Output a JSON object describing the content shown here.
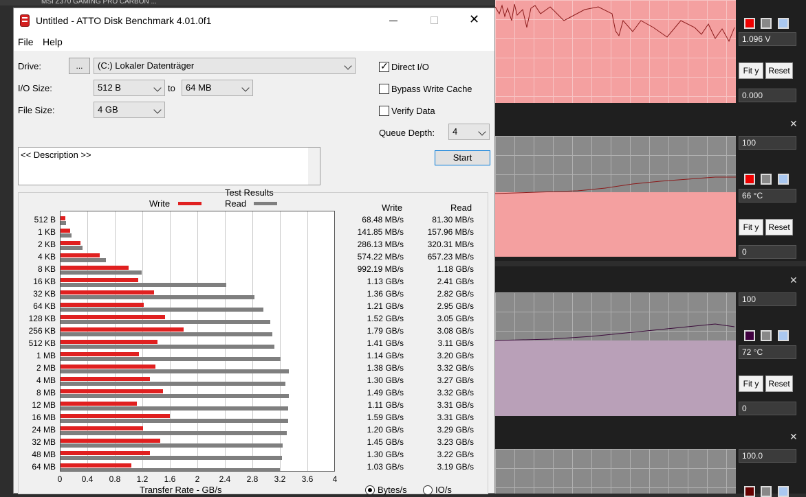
{
  "background": {
    "window_title": "MSI Z370 GAMING PRO CARBON ...",
    "panels": [
      {
        "value_top": "1.096 V",
        "value_bottom": "0.000"
      },
      {
        "value_top": "100",
        "value_mid": "66 °C",
        "value_bottom": "0"
      },
      {
        "value_top": "100",
        "value_mid": "72 °C",
        "value_bottom": "0"
      },
      {
        "value_top": "100.0"
      }
    ],
    "fit_label": "Fit y",
    "reset_label": "Reset"
  },
  "app": {
    "title": "Untitled - ATTO Disk Benchmark 4.01.0f1",
    "menu": [
      "File",
      "Help"
    ],
    "drive_label": "Drive:",
    "browse_label": "...",
    "drive_value": "(C:) Lokaler Datenträger",
    "io_size_label": "I/O Size:",
    "io_from": "512 B",
    "to_label": "to",
    "io_to": "64 MB",
    "file_size_label": "File Size:",
    "file_size": "4 GB",
    "direct_io": "Direct I/O",
    "bypass_write_cache": "Bypass Write Cache",
    "verify_data": "Verify Data",
    "queue_depth_label": "Queue Depth:",
    "queue_depth": "4",
    "start_label": "Start",
    "description": "<< Description >>",
    "results_title": "Test Results",
    "legend_write": "Write",
    "legend_read": "Read",
    "col_write": "Write",
    "col_read": "Read",
    "xlabel": "Transfer Rate - GB/s",
    "radio_bytes": "Bytes/s",
    "radio_io": "IO/s",
    "colors": {
      "write": "#e02020",
      "read": "#7f7f7f"
    }
  },
  "chart_data": {
    "type": "bar",
    "orientation": "horizontal",
    "title": "Test Results",
    "xlabel": "Transfer Rate - GB/s",
    "xlim": [
      0,
      4
    ],
    "xticks": [
      "0",
      "0.4",
      "0.8",
      "1.2",
      "1.6",
      "2",
      "2.4",
      "2.8",
      "3.2",
      "3.6",
      "4"
    ],
    "categories": [
      "512 B",
      "1 KB",
      "2 KB",
      "4 KB",
      "8 KB",
      "16 KB",
      "32 KB",
      "64 KB",
      "128 KB",
      "256 KB",
      "512 KB",
      "1 MB",
      "2 MB",
      "4 MB",
      "8 MB",
      "12 MB",
      "16 MB",
      "24 MB",
      "32 MB",
      "48 MB",
      "64 MB"
    ],
    "series": [
      {
        "name": "Write",
        "values": [
          0.068,
          0.142,
          0.286,
          0.574,
          0.992,
          1.13,
          1.36,
          1.21,
          1.52,
          1.79,
          1.41,
          1.14,
          1.38,
          1.3,
          1.49,
          1.11,
          1.59,
          1.2,
          1.45,
          1.3,
          1.03
        ]
      },
      {
        "name": "Read",
        "values": [
          0.081,
          0.158,
          0.32,
          0.657,
          1.18,
          2.41,
          2.82,
          2.95,
          3.05,
          3.08,
          3.11,
          3.2,
          3.32,
          3.27,
          3.32,
          3.31,
          3.31,
          3.29,
          3.23,
          3.22,
          3.19
        ]
      }
    ],
    "write_labels": [
      "68.48 MB/s",
      "141.85 MB/s",
      "286.13 MB/s",
      "574.22 MB/s",
      "992.19 MB/s",
      "1.13 GB/s",
      "1.36 GB/s",
      "1.21 GB/s",
      "1.52 GB/s",
      "1.79 GB/s",
      "1.41 GB/s",
      "1.14 GB/s",
      "1.38 GB/s",
      "1.30 GB/s",
      "1.49 GB/s",
      "1.11 GB/s",
      "1.59 GB/s",
      "1.20 GB/s",
      "1.45 GB/s",
      "1.30 GB/s",
      "1.03 GB/s"
    ],
    "read_labels": [
      "81.30 MB/s",
      "157.96 MB/s",
      "320.31 MB/s",
      "657.23 MB/s",
      "1.18 GB/s",
      "2.41 GB/s",
      "2.82 GB/s",
      "2.95 GB/s",
      "3.05 GB/s",
      "3.08 GB/s",
      "3.11 GB/s",
      "3.20 GB/s",
      "3.32 GB/s",
      "3.27 GB/s",
      "3.32 GB/s",
      "3.31 GB/s",
      "3.31 GB/s",
      "3.29 GB/s",
      "3.23 GB/s",
      "3.22 GB/s",
      "3.19 GB/s"
    ],
    "legend": "top"
  }
}
